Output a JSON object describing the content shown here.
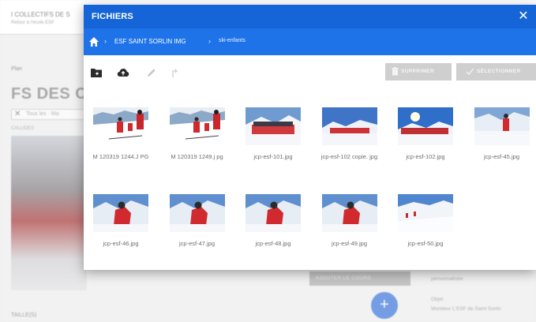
{
  "background": {
    "header_title": "I COLLECTIFS DE S",
    "header_sub": "Retour à l'école ESF",
    "crumb": "Plan",
    "heading": "FS DES CO",
    "chip_text": "Tous les · Ma",
    "chip_close": "✕",
    "small_label": "CALLIDES",
    "bar_label": "AJOUTER LE COURS",
    "fab_plus": "+",
    "bottom_label": "TAILLE(S)",
    "right_a": "personnalisée",
    "right_b": "Objet",
    "right_c": "Moniteur L'ESF de Saint Sorlin"
  },
  "modal": {
    "title": "FICHIERS",
    "close": "✕",
    "path": {
      "home_icon": "home-icon",
      "separator": "›",
      "items": [
        "ESF SAINT SORLIN IMG",
        "ski-enfants"
      ]
    },
    "toolbar": {
      "icons": [
        "new-folder-icon",
        "upload-icon",
        "edit-icon",
        "move-icon"
      ],
      "delete_label": "SUPPRIMER",
      "select_label": "SÉLECTIONNER"
    },
    "files": [
      {
        "name": "M 120319 1244.J PG",
        "scene": "two-skiers-red"
      },
      {
        "name": "M 120319 1249.j pg",
        "scene": "two-skiers-red"
      },
      {
        "name": "jcp-esf-101.jpg",
        "scene": "group"
      },
      {
        "name": "jcp-esf-102 copie. jpg",
        "scene": "group-wide"
      },
      {
        "name": "jcp-esf-102.jpg",
        "scene": "group-sun"
      },
      {
        "name": "jcp-esf-45.jpg",
        "scene": "single-skier"
      },
      {
        "name": "jcp-esf-46.jpg",
        "scene": "skier-close"
      },
      {
        "name": "jcp-esf-47.jpg",
        "scene": "skier-close"
      },
      {
        "name": "jcp-esf-48.jpg",
        "scene": "skier-close"
      },
      {
        "name": "jcp-esf-49.jpg",
        "scene": "skier-close"
      },
      {
        "name": "jcp-esf-50.jpg",
        "scene": "slope"
      }
    ]
  },
  "colors": {
    "titlebar": "#1565d8",
    "pathbar": "#1e73e8",
    "button_disabled": "#cfcfcf",
    "fab": "#5f8fe2"
  }
}
